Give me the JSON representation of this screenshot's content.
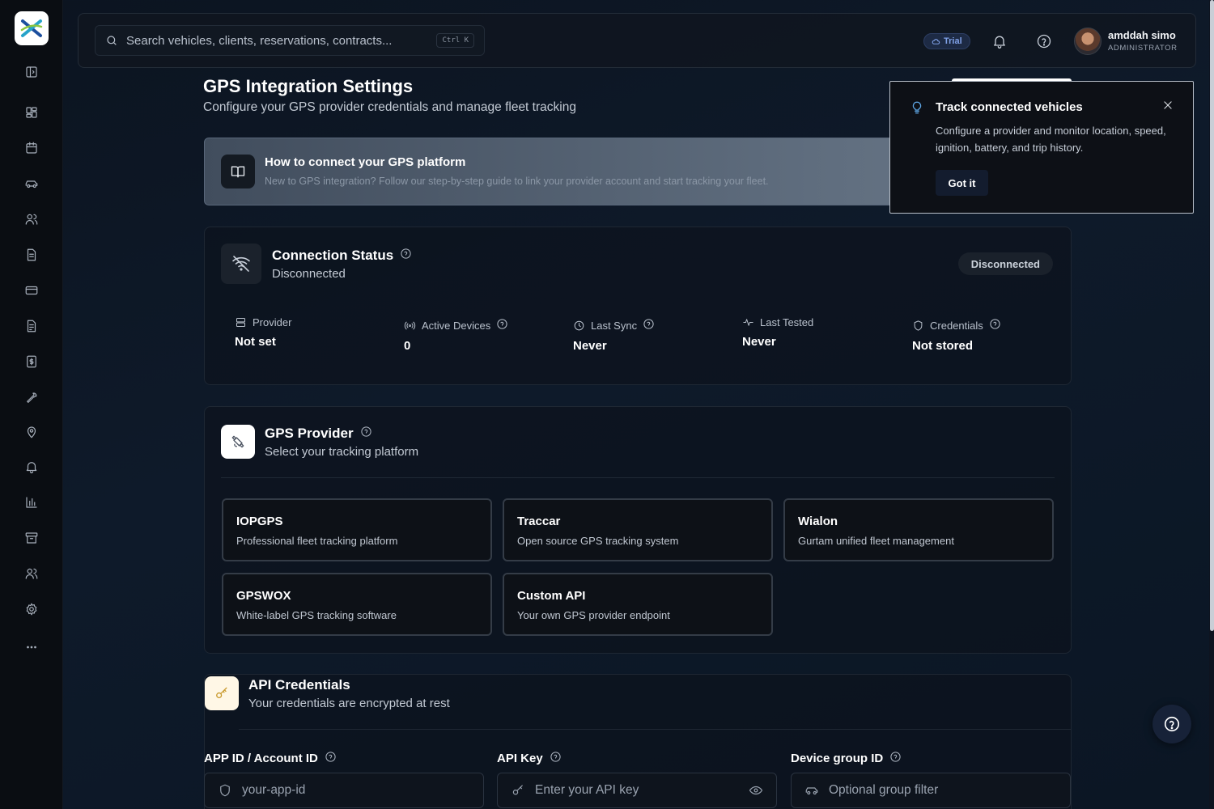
{
  "search": {
    "placeholder": "Search vehicles, clients, reservations, contracts...",
    "shortcut": "Ctrl K"
  },
  "header": {
    "trial_label": "Trial",
    "user_name": "amddah simo",
    "user_role": "ADMINISTRATOR"
  },
  "page": {
    "title": "GPS Integration Settings",
    "subtitle": "Configure your GPS provider credentials and manage fleet tracking"
  },
  "guide": {
    "title": "How to connect your GPS platform",
    "description": "New to GPS integration? Follow our step-by-step guide to link your provider account and start tracking your fleet."
  },
  "connection": {
    "title": "Connection Status",
    "subtitle": "Disconnected",
    "badge": "Disconnected",
    "stats": [
      {
        "label": "Provider",
        "value": "Not set"
      },
      {
        "label": "Active Devices",
        "value": "0"
      },
      {
        "label": "Last Sync",
        "value": "Never"
      },
      {
        "label": "Last Tested",
        "value": "Never"
      },
      {
        "label": "Credentials",
        "value": "Not stored"
      }
    ]
  },
  "gps_provider": {
    "title": "GPS Provider",
    "subtitle": "Select your tracking platform",
    "options": [
      {
        "name": "IOPGPS",
        "description": "Professional fleet tracking platform"
      },
      {
        "name": "Traccar",
        "description": "Open source GPS tracking system"
      },
      {
        "name": "Wialon",
        "description": "Gurtam unified fleet management"
      },
      {
        "name": "GPSWOX",
        "description": "White-label GPS tracking software"
      },
      {
        "name": "Custom API",
        "description": "Your own GPS provider endpoint"
      }
    ]
  },
  "credentials": {
    "title": "API Credentials",
    "subtitle": "Your credentials are encrypted at rest",
    "fields": [
      {
        "label": "APP ID / Account ID",
        "placeholder": "your-app-id",
        "value": ""
      },
      {
        "label": "API Key",
        "placeholder": "Enter your API key",
        "value": ""
      },
      {
        "label": "Device group ID",
        "placeholder": "Optional group filter",
        "value": ""
      }
    ]
  },
  "popover": {
    "title": "Track connected vehicles",
    "body": "Configure a provider and monitor location, speed, ignition, battery, and trip history.",
    "button": "Got it"
  },
  "colors": {
    "accent": "#5fa8e8",
    "trial": "#7fa0e6",
    "background": "#0e1a2a"
  }
}
